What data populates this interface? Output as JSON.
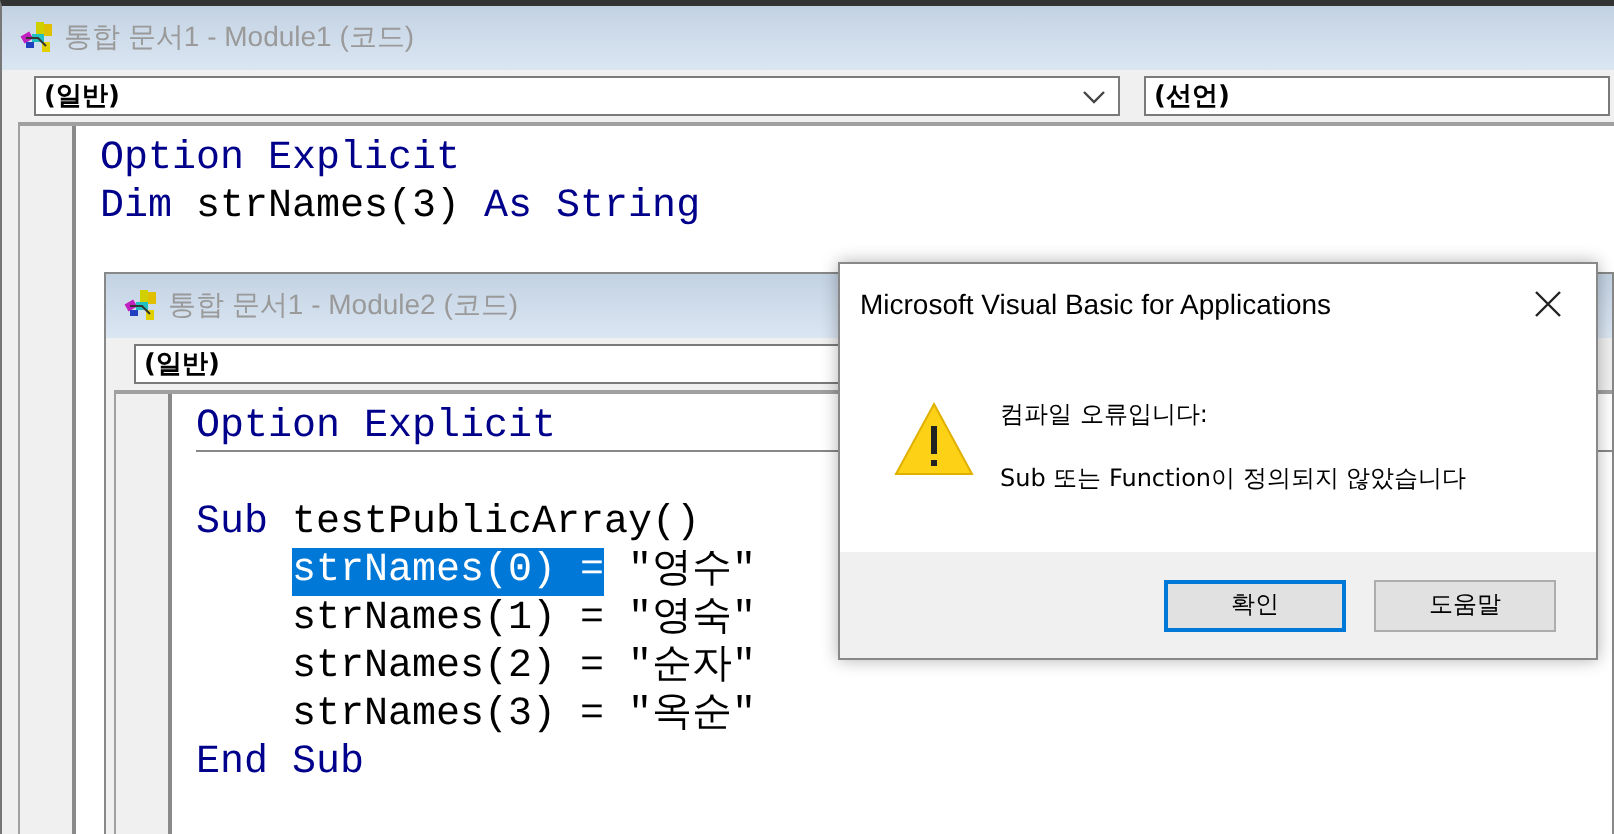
{
  "windows": [
    {
      "title": "통합 문서1 - Module1 (코드)",
      "object_combo": "(일반)",
      "procedure_combo": "(선언)",
      "code_lines": [
        {
          "kind": "code",
          "separator_after": false,
          "indented": false,
          "segments": [
            {
              "kind": "keyword",
              "text": "Option Explicit"
            }
          ]
        },
        {
          "kind": "code",
          "separator_after": false,
          "indented": false,
          "segments": [
            {
              "kind": "keyword",
              "text": "Dim"
            },
            {
              "kind": "plain",
              "text": " strNames(3) "
            },
            {
              "kind": "keyword",
              "text": "As String"
            }
          ]
        }
      ]
    },
    {
      "title": "통합 문서1 - Module2 (코드)",
      "object_combo": "(일반)",
      "code_lines": [
        {
          "kind": "code",
          "separator_after": true,
          "indented": false,
          "segments": [
            {
              "kind": "keyword",
              "text": "Option Explicit"
            }
          ]
        },
        {
          "kind": "blank"
        },
        {
          "kind": "code",
          "separator_after": false,
          "indented": false,
          "segments": [
            {
              "kind": "keyword",
              "text": "Sub"
            },
            {
              "kind": "plain",
              "text": " testPublicArray()"
            }
          ]
        },
        {
          "kind": "code",
          "separator_after": false,
          "indented": true,
          "segments": [
            {
              "kind": "selection",
              "text": "strNames(0) ="
            },
            {
              "kind": "plain",
              "text": " \"영수\""
            }
          ]
        },
        {
          "kind": "code",
          "separator_after": false,
          "indented": true,
          "segments": [
            {
              "kind": "plain",
              "text": "strNames(1) = \"영숙\""
            }
          ]
        },
        {
          "kind": "code",
          "separator_after": false,
          "indented": true,
          "segments": [
            {
              "kind": "plain",
              "text": "strNames(2) = \"순자\""
            }
          ]
        },
        {
          "kind": "code",
          "separator_after": false,
          "indented": true,
          "segments": [
            {
              "kind": "plain",
              "text": "strNames(3) = \"옥순\""
            }
          ]
        },
        {
          "kind": "code",
          "separator_after": false,
          "indented": false,
          "segments": [
            {
              "kind": "keyword",
              "text": "End Sub"
            }
          ]
        }
      ]
    }
  ],
  "dialog": {
    "title": "Microsoft Visual Basic for Applications",
    "kind": "warning",
    "heading": "컴파일 오류입니다:",
    "message": "Sub 또는 Function이 정의되지 않았습니다",
    "buttons": [
      {
        "label": "확인",
        "focused": true
      },
      {
        "label": "도움말",
        "focused": false
      }
    ]
  }
}
